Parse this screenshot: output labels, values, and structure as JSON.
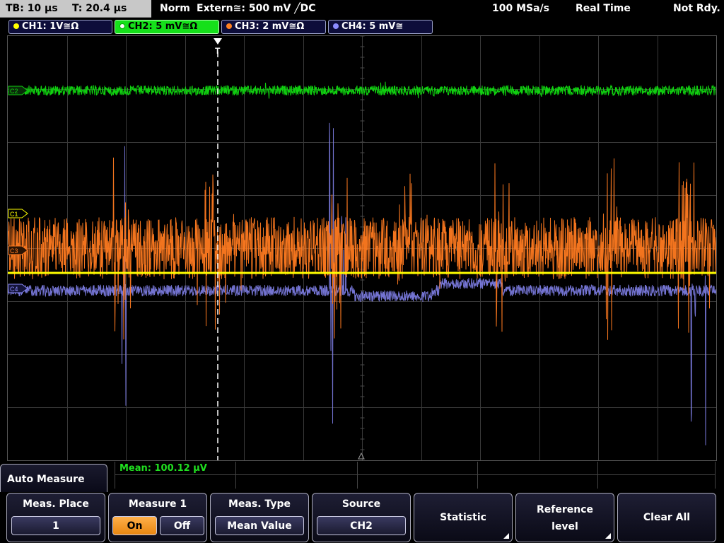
{
  "statusbar": {
    "timebase": "TB: 10 µs",
    "trigger_time": "T: 20.4 µs",
    "mode": "Norm",
    "trigger_source": "Extern≅: 500 mV ╱DC",
    "sample_rate": "100 MSa/s",
    "acquisition": "Real Time",
    "state": "Not Rdy."
  },
  "channels": [
    {
      "label": "CH1: 1V≅Ω",
      "color": "#ffff00",
      "active": false
    },
    {
      "label": "CH2: 5 mV≅Ω",
      "color": "#00d000",
      "active": true
    },
    {
      "label": "CH3: 2 mV≅Ω",
      "color": "#ff8020",
      "active": false
    },
    {
      "label": "CH4: 5 mV≅",
      "color": "#8c8cff",
      "active": false
    }
  ],
  "markers": {
    "c2": "C2",
    "c1": "C1",
    "c3": "C3",
    "c4": "C4",
    "trigger": "T"
  },
  "measurement": {
    "readout": "Mean: 100.12 µV"
  },
  "menu": {
    "title": "Auto Measure"
  },
  "softkeys": {
    "meas_place": {
      "label": "Meas. Place",
      "value": "1"
    },
    "measure1": {
      "label": "Measure 1",
      "on": "On",
      "off": "Off"
    },
    "meas_type": {
      "label": "Meas. Type",
      "value": "Mean Value"
    },
    "source": {
      "label": "Source",
      "value": "CH2"
    },
    "statistic": {
      "label": "Statistic"
    },
    "reference": {
      "label_line1": "Reference",
      "label_line2": "level"
    },
    "clear_all": {
      "label": "Clear All"
    }
  },
  "colors": {
    "ch1": "#ffff00",
    "ch2": "#10d010",
    "ch3": "#ff7a20",
    "ch4": "#7f7fe8",
    "grid": "#3a3a3a"
  }
}
